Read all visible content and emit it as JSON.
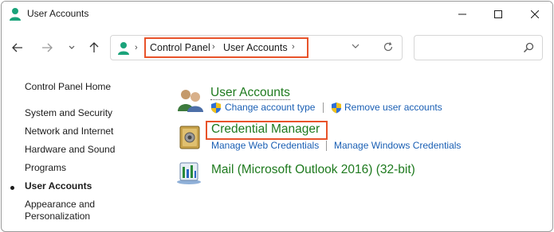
{
  "window": {
    "title": "User Accounts",
    "controls": {
      "minimize": "minimize-icon",
      "maximize": "maximize-icon",
      "close": "close-icon"
    }
  },
  "nav": {
    "back": "arrow-left-icon",
    "forward": "arrow-right-icon",
    "recent": "chevron-down-icon",
    "up": "arrow-up-icon",
    "breadcrumb": [
      "Control Panel",
      "User Accounts"
    ],
    "search_placeholder": ""
  },
  "sidebar": {
    "items": [
      {
        "label": "Control Panel Home",
        "selected": false
      },
      {
        "label": "System and Security",
        "selected": false
      },
      {
        "label": "Network and Internet",
        "selected": false
      },
      {
        "label": "Hardware and Sound",
        "selected": false
      },
      {
        "label": "Programs",
        "selected": false
      },
      {
        "label": "User Accounts",
        "selected": true
      },
      {
        "label": "Appearance and",
        "selected": false
      },
      {
        "label": "Personalization",
        "selected": false
      }
    ]
  },
  "categories": {
    "user_accounts": {
      "title": "User Accounts",
      "links": [
        "Change account type",
        "Remove user accounts"
      ]
    },
    "credential_manager": {
      "title": "Credential Manager",
      "links": [
        "Manage Web Credentials",
        "Manage Windows Credentials"
      ]
    },
    "mail": {
      "title": "Mail (Microsoft Outlook 2016) (32-bit)"
    }
  },
  "colors": {
    "category_title": "#1e7a1e",
    "link": "#1a5fb4",
    "highlight": "#e8532a"
  }
}
